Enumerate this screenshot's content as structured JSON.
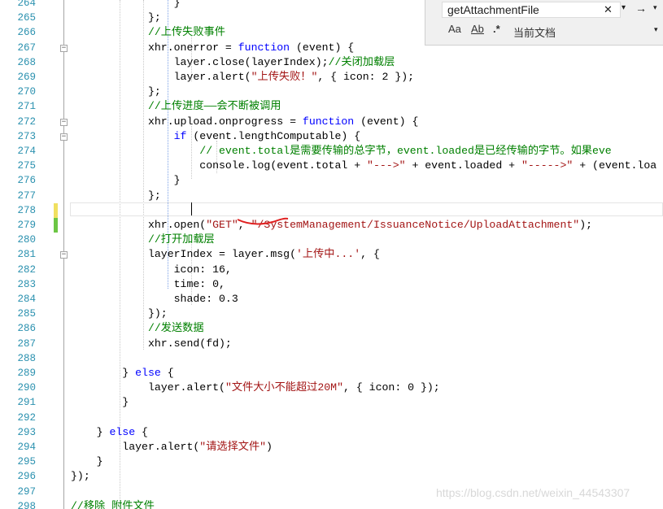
{
  "find": {
    "query": "getAttachmentFile",
    "close_glyph": "✕",
    "dropdown_glyph": "▾",
    "next_glyph": "→",
    "match_case_label": "Aa",
    "whole_word_label": "Ab",
    "regex_label": ".*",
    "scope_label": "当前文档"
  },
  "lines": [
    {
      "n": "264",
      "t": "                }"
    },
    {
      "n": "265",
      "t": "            };"
    },
    {
      "n": "266",
      "t": "            //上传失败事件"
    },
    {
      "n": "267",
      "t": "            xhr.onerror = function (event) {"
    },
    {
      "n": "268",
      "t": "                layer.close(layerIndex);//关闭加载层"
    },
    {
      "n": "269",
      "t": "                layer.alert(\"上传失败！\", { icon: 2 });"
    },
    {
      "n": "270",
      "t": "            };"
    },
    {
      "n": "271",
      "t": "            //上传进度——会不断被调用"
    },
    {
      "n": "272",
      "t": "            xhr.upload.onprogress = function (event) {"
    },
    {
      "n": "273",
      "t": "                if (event.lengthComputable) {"
    },
    {
      "n": "274",
      "t": "                    // event.total是需要传输的总字节，event.loaded是已经传输的字节。如果eve"
    },
    {
      "n": "275",
      "t": "                    console.log(event.total + \"--->\" + event.loaded + \"----->\" + (event.loa"
    },
    {
      "n": "276",
      "t": "                }"
    },
    {
      "n": "277",
      "t": "            };"
    },
    {
      "n": "278",
      "t": ""
    },
    {
      "n": "279",
      "t": "            xhr.open(\"GET\", \"/SystemManagement/IssuanceNotice/UploadAttachment\");"
    },
    {
      "n": "280",
      "t": "            //打开加载层"
    },
    {
      "n": "281",
      "t": "            layerIndex = layer.msg('上传中...', {"
    },
    {
      "n": "282",
      "t": "                icon: 16,"
    },
    {
      "n": "283",
      "t": "                time: 0,"
    },
    {
      "n": "284",
      "t": "                shade: 0.3"
    },
    {
      "n": "285",
      "t": "            });"
    },
    {
      "n": "286",
      "t": "            //发送数据"
    },
    {
      "n": "287",
      "t": "            xhr.send(fd);"
    },
    {
      "n": "288",
      "t": ""
    },
    {
      "n": "289",
      "t": "        } else {"
    },
    {
      "n": "290",
      "t": "            layer.alert(\"文件大小不能超过20M\", { icon: 0 });"
    },
    {
      "n": "291",
      "t": "        }"
    },
    {
      "n": "292",
      "t": ""
    },
    {
      "n": "293",
      "t": "    } else {"
    },
    {
      "n": "294",
      "t": "        layer.alert(\"请选择文件\")"
    },
    {
      "n": "295",
      "t": "    }"
    },
    {
      "n": "296",
      "t": "});"
    },
    {
      "n": "297",
      "t": ""
    },
    {
      "n": "298",
      "t": "//移除 附件文件"
    }
  ],
  "watermark": "https://blog.csdn.net/weixin_44543307",
  "colors": {
    "keyword": "#0000ff",
    "string": "#a31515",
    "comment": "#008000",
    "line_number": "#2b91af",
    "change_saved": "#6cc644",
    "change_unsaved": "#f0e060"
  }
}
